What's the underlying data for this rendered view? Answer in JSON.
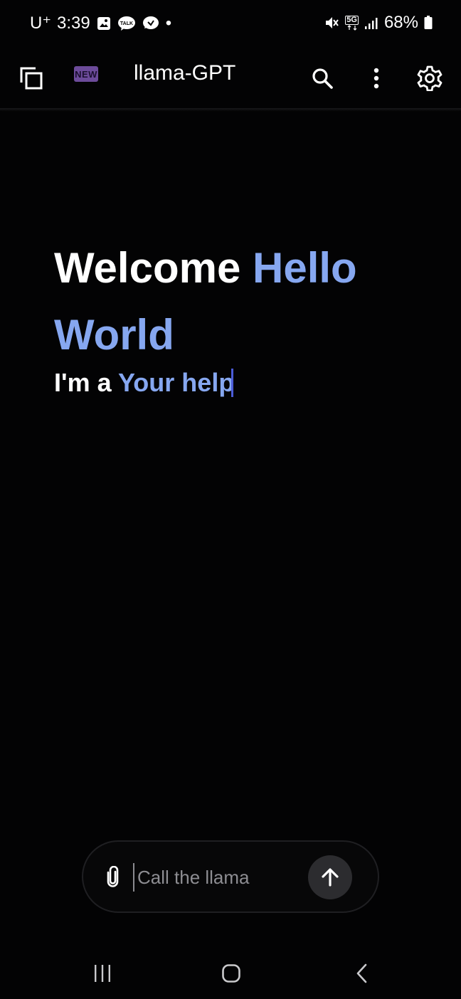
{
  "status_bar": {
    "carrier": "U⁺",
    "time": "3:39",
    "notification_icons": [
      "gallery-icon",
      "talk-icon",
      "messenger-icon"
    ],
    "dot": "•",
    "network": "5G",
    "battery_percent": "68%"
  },
  "app_bar": {
    "title": "llama-GPT",
    "new_badge": "NEW",
    "icons": [
      "copy-chats-icon",
      "search-icon",
      "more-vert-icon",
      "settings-gear-icon"
    ]
  },
  "welcome": {
    "title_prefix": "Welcome",
    "title_highlight": "Hello World",
    "subtitle_prefix": "I'm a",
    "subtitle_highlight": "Your help"
  },
  "composer": {
    "placeholder": "Call the llama",
    "attach_icon": "paperclip-icon",
    "send_icon": "arrow-up-icon"
  },
  "nav_bar": {
    "icons": [
      "recent-apps-icon",
      "home-icon",
      "back-icon"
    ]
  },
  "colors": {
    "background": "#030304",
    "accent_blue": "#86a7f0",
    "badge_purple": "#6c4b9a",
    "send_button": "#2c2c2f"
  }
}
